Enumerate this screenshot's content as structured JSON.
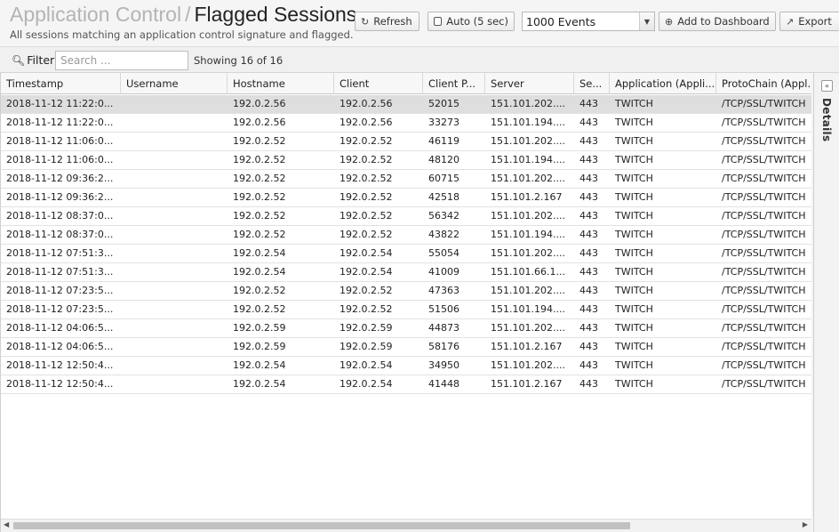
{
  "header": {
    "breadcrumb_parent": "Application Control",
    "breadcrumb_sep": "/",
    "title": "Flagged Sessions",
    "subtitle": "All sessions matching an application control signature and flagged."
  },
  "toolbar": {
    "refresh_label": "Refresh",
    "auto_label": "Auto (5 sec)",
    "events_select_value": "1000 Events",
    "add_dashboard_label": "Add to Dashboard",
    "export_label": "Export"
  },
  "filter": {
    "label": "Filter",
    "search_placeholder": "Search ...",
    "search_value": "",
    "showing_text": "Showing 16 of 16"
  },
  "table": {
    "columns": [
      "Timestamp",
      "Username",
      "Hostname",
      "Client",
      "Client P...",
      "Server",
      "Se...",
      "Application (Appli...",
      "ProtoChain (Appl..."
    ],
    "rows": [
      [
        "2018-11-12 11:22:0...",
        "",
        "192.0.2.56",
        "192.0.2.56",
        "52015",
        "151.101.202....",
        "443",
        "TWITCH",
        "/TCP/SSL/TWITCH"
      ],
      [
        "2018-11-12 11:22:0...",
        "",
        "192.0.2.56",
        "192.0.2.56",
        "33273",
        "151.101.194....",
        "443",
        "TWITCH",
        "/TCP/SSL/TWITCH"
      ],
      [
        "2018-11-12 11:06:0...",
        "",
        "192.0.2.52",
        "192.0.2.52",
        "46119",
        "151.101.202....",
        "443",
        "TWITCH",
        "/TCP/SSL/TWITCH"
      ],
      [
        "2018-11-12 11:06:0...",
        "",
        "192.0.2.52",
        "192.0.2.52",
        "48120",
        "151.101.194....",
        "443",
        "TWITCH",
        "/TCP/SSL/TWITCH"
      ],
      [
        "2018-11-12 09:36:2...",
        "",
        "192.0.2.52",
        "192.0.2.52",
        "60715",
        "151.101.202....",
        "443",
        "TWITCH",
        "/TCP/SSL/TWITCH"
      ],
      [
        "2018-11-12 09:36:2...",
        "",
        "192.0.2.52",
        "192.0.2.52",
        "42518",
        "151.101.2.167",
        "443",
        "TWITCH",
        "/TCP/SSL/TWITCH"
      ],
      [
        "2018-11-12 08:37:0...",
        "",
        "192.0.2.52",
        "192.0.2.52",
        "56342",
        "151.101.202....",
        "443",
        "TWITCH",
        "/TCP/SSL/TWITCH"
      ],
      [
        "2018-11-12 08:37:0...",
        "",
        "192.0.2.52",
        "192.0.2.52",
        "43822",
        "151.101.194....",
        "443",
        "TWITCH",
        "/TCP/SSL/TWITCH"
      ],
      [
        "2018-11-12 07:51:3...",
        "",
        "192.0.2.54",
        "192.0.2.54",
        "55054",
        "151.101.202....",
        "443",
        "TWITCH",
        "/TCP/SSL/TWITCH"
      ],
      [
        "2018-11-12 07:51:3...",
        "",
        "192.0.2.54",
        "192.0.2.54",
        "41009",
        "151.101.66.1...",
        "443",
        "TWITCH",
        "/TCP/SSL/TWITCH"
      ],
      [
        "2018-11-12 07:23:5...",
        "",
        "192.0.2.52",
        "192.0.2.52",
        "47363",
        "151.101.202....",
        "443",
        "TWITCH",
        "/TCP/SSL/TWITCH"
      ],
      [
        "2018-11-12 07:23:5...",
        "",
        "192.0.2.52",
        "192.0.2.52",
        "51506",
        "151.101.194....",
        "443",
        "TWITCH",
        "/TCP/SSL/TWITCH"
      ],
      [
        "2018-11-12 04:06:5...",
        "",
        "192.0.2.59",
        "192.0.2.59",
        "44873",
        "151.101.202....",
        "443",
        "TWITCH",
        "/TCP/SSL/TWITCH"
      ],
      [
        "2018-11-12 04:06:5...",
        "",
        "192.0.2.59",
        "192.0.2.59",
        "58176",
        "151.101.2.167",
        "443",
        "TWITCH",
        "/TCP/SSL/TWITCH"
      ],
      [
        "2018-11-12 12:50:4...",
        "",
        "192.0.2.54",
        "192.0.2.54",
        "34950",
        "151.101.202....",
        "443",
        "TWITCH",
        "/TCP/SSL/TWITCH"
      ],
      [
        "2018-11-12 12:50:4...",
        "",
        "192.0.2.54",
        "192.0.2.54",
        "41448",
        "151.101.2.167",
        "443",
        "TWITCH",
        "/TCP/SSL/TWITCH"
      ]
    ]
  },
  "details_panel": {
    "label": "Details"
  },
  "icons": {
    "refresh": "refresh-icon",
    "checkbox": "checkbox-icon",
    "dropdown": "chevron-down-icon",
    "add": "plus-circle-icon",
    "export": "export-icon",
    "search": "search-icon",
    "collapse": "double-chevron-left-icon"
  },
  "colors": {
    "title_muted": "#b4b4b4",
    "selected_row": "#dedede",
    "header_bg": "#f7f7f7"
  }
}
